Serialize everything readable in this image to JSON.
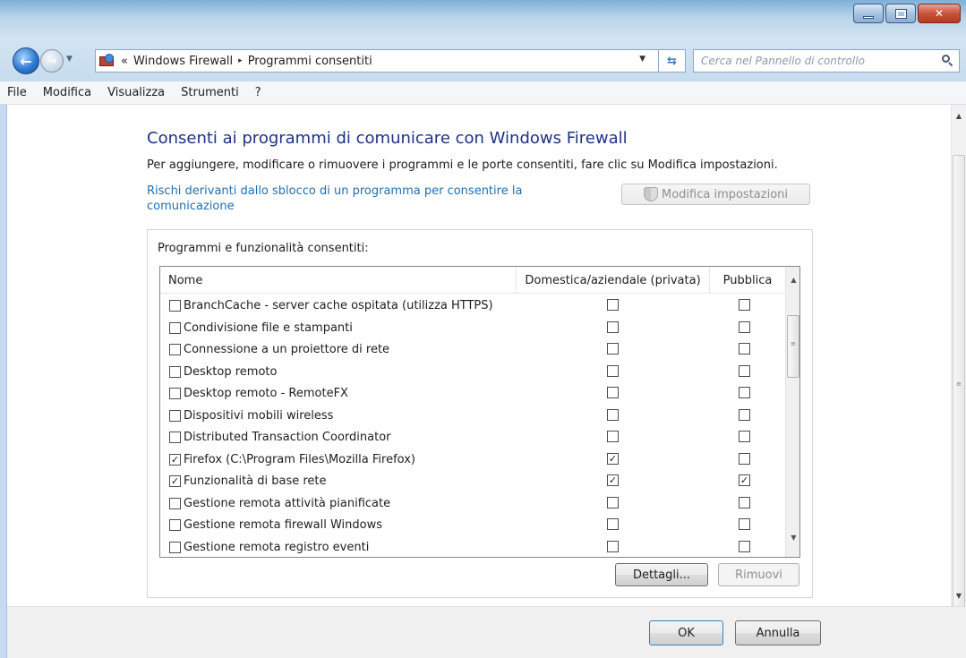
{
  "navigation": {
    "breadcrumb_prefix": "«",
    "breadcrumb_1": "Windows Firewall",
    "breadcrumb_sep": "▸",
    "breadcrumb_2": "Programmi consentiti",
    "search_placeholder": "Cerca nel Pannello di controllo"
  },
  "menu": {
    "file": "File",
    "modifica": "Modifica",
    "visualizza": "Visualizza",
    "strumenti": "Strumenti",
    "help": "?"
  },
  "page": {
    "title": "Consenti ai programmi di comunicare con Windows Firewall",
    "description": "Per aggiungere, modificare o rimuovere i programmi e le porte consentiti, fare clic su Modifica impostazioni.",
    "risk_link": "Rischi derivanti dallo sblocco di un programma per consentire la comunicazione",
    "modify_button": "Modifica impostazioni"
  },
  "group": {
    "label": "Programmi e funzionalità consentiti:",
    "columns": {
      "name": "Nome",
      "home": "Domestica/aziendale (privata)",
      "public": "Pubblica"
    },
    "rows": [
      {
        "name": "BranchCache - server cache ospitata (utilizza HTTPS)",
        "enabled": false,
        "home": false,
        "public": false
      },
      {
        "name": "Condivisione file e stampanti",
        "enabled": false,
        "home": false,
        "public": false
      },
      {
        "name": "Connessione a un proiettore di rete",
        "enabled": false,
        "home": false,
        "public": false
      },
      {
        "name": "Desktop remoto",
        "enabled": false,
        "home": false,
        "public": false
      },
      {
        "name": "Desktop remoto - RemoteFX",
        "enabled": false,
        "home": false,
        "public": false
      },
      {
        "name": "Dispositivi mobili wireless",
        "enabled": false,
        "home": false,
        "public": false
      },
      {
        "name": "Distributed Transaction Coordinator",
        "enabled": false,
        "home": false,
        "public": false
      },
      {
        "name": "Firefox (C:\\Program Files\\Mozilla Firefox)",
        "enabled": true,
        "home": true,
        "public": false
      },
      {
        "name": "Funzionalità di base rete",
        "enabled": true,
        "home": true,
        "public": true
      },
      {
        "name": "Gestione remota attività pianificate",
        "enabled": false,
        "home": false,
        "public": false
      },
      {
        "name": "Gestione remota firewall Windows",
        "enabled": false,
        "home": false,
        "public": false
      },
      {
        "name": "Gestione remota registro eventi",
        "enabled": false,
        "home": false,
        "public": false
      }
    ],
    "details_button": "Dettagli...",
    "remove_button": "Rimuovi"
  },
  "footer": {
    "ok_button": "OK",
    "cancel_button": "Annulla"
  },
  "colors": {
    "title_color": "#1e3287",
    "link_color": "#1f6fb2",
    "titlebar_top": "#7fb0d8",
    "close_button": "#c9523a"
  },
  "icons": {
    "back": "back-arrow-icon",
    "forward": "forward-arrow-icon",
    "address": "firewall-icon",
    "refresh": "refresh-icon",
    "search": "search-icon",
    "shield": "uac-shield-icon"
  }
}
